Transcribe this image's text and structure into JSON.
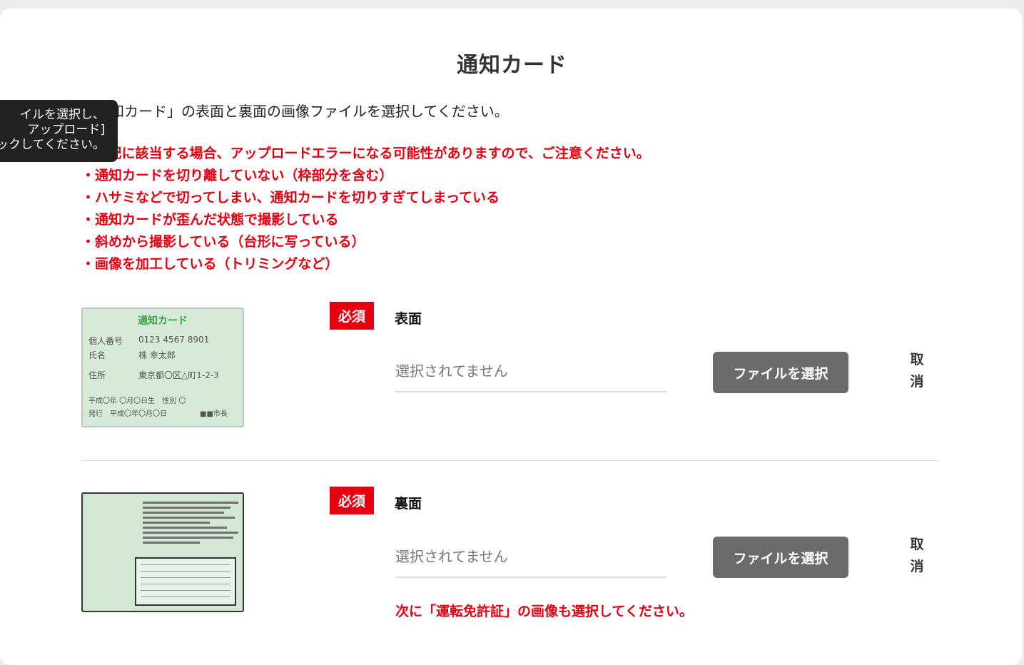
{
  "page": {
    "title": "通知カード",
    "intro": "「通知カード」の表面と裏面の画像ファイルを選択してください。",
    "notes": [
      "※下記に該当する場合、アップロードエラーになる可能性がありますので、ご注意ください。",
      "・通知カードを切り離していない（枠部分を含む）",
      "・ハサミなどで切ってしまい、通知カードを切りすぎてしまっている",
      "・通知カードが歪んだ状態で撮影している",
      "・斜めから撮影している（台形に写っている）",
      "・画像を加工している（トリミングなど）"
    ]
  },
  "tooltip": {
    "lines": [
      "イルを選択し、",
      "アップロード]",
      "ックしてください。"
    ]
  },
  "sample_card": {
    "title": "通知カード",
    "number_label": "個人番号",
    "number_value": "0123 4567 8901",
    "name_label": "氏名",
    "name_value": "株 幸太郎",
    "address_label": "住所",
    "address_value": "東京都〇区△町1-2-3",
    "birth_line": "平成〇年 〇月〇日生　性別 〇",
    "issue_line": "発行　平成〇年〇月〇日",
    "issuer": "■■市長"
  },
  "front": {
    "badge": "必須",
    "label": "表面",
    "placeholder": "選択されてません",
    "button": "ファイルを選択",
    "cancel": "取\n消"
  },
  "back": {
    "badge": "必須",
    "label": "裏面",
    "placeholder": "選択されてません",
    "button": "ファイルを選択",
    "cancel": "取\n消",
    "next_message": "次に「運転免許証」の画像も選択してください。"
  },
  "colors": {
    "accent_red": "#e60012",
    "button_gray": "#6b6b6b",
    "card_green": "#d7e9d8"
  }
}
